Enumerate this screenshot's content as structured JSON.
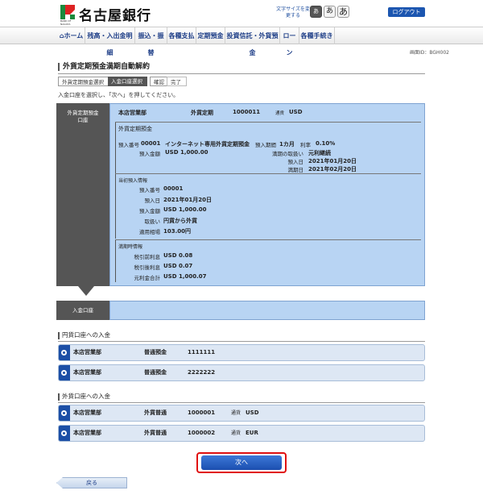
{
  "header": {
    "bank_name": "名古屋銀行",
    "logo_sub": "BANK OF NAGOYA",
    "font_size_label": "文字サイズを変更する",
    "font_btn_small": "あ",
    "font_btn_medium": "あ",
    "font_btn_large": "あ",
    "logout": "ログアウト"
  },
  "nav": {
    "items": [
      "ホーム",
      "残高・入出金明細",
      "振込・振替",
      "各種支払",
      "定期預金",
      "投資信託・外貨預金",
      "ローン",
      "各種手続き"
    ]
  },
  "screen_id": "画面ID：BGH002",
  "page_title": "外貨定期預金満期自動解約",
  "steps": [
    "外貨定期預金選択",
    "入金口座選択",
    "確認",
    "完了"
  ],
  "instruction": "入金口座を選択し、「次へ」を押してください。",
  "source_account": {
    "label_line1": "外貨定期預金",
    "label_line2": "口座",
    "branch": "本店営業部",
    "type": "外貨定期",
    "number": "1000011",
    "currency_label": "通貨",
    "currency": "USD",
    "section1_title": "外貨定期預金",
    "deposit_no_label": "預入番号",
    "deposit_no": "00001",
    "product": "インターネット専用外貨定期預金",
    "period_label": "預入期間",
    "period": "1カ月",
    "rate_label": "利率",
    "rate": "0.10%",
    "amount_label": "預入金額",
    "amount": "USD 1,000.00",
    "maturity_handling_label": "満期の取扱い",
    "maturity_handling": "元利継続",
    "deposit_date_label": "預入日",
    "deposit_date": "2021年01月20日",
    "maturity_date_label": "満期日",
    "maturity_date": "2021年02月20日",
    "section2_title": "当初預入情報",
    "init_no_label": "預入番号",
    "init_no": "00001",
    "init_date_label": "預入日",
    "init_date": "2021年01月20日",
    "init_amount_label": "預入金額",
    "init_amount": "USD 1,000.00",
    "init_handling_label": "取扱い",
    "init_handling": "円貨から外貨",
    "init_rate_label": "適用相場",
    "init_rate": "103.00円",
    "section3_title": "満期時情報",
    "pre_tax_label": "税引前利息",
    "pre_tax": "USD 0.08",
    "post_tax_label": "税引後利息",
    "post_tax": "USD 0.07",
    "total_label": "元利金合計",
    "total": "USD 1,000.07"
  },
  "deposit_account_label": "入金口座",
  "yen_group_title": "円貨口座への入金",
  "yen_accounts": [
    {
      "branch": "本店営業部",
      "type": "普通預金",
      "number": "1111111"
    },
    {
      "branch": "本店営業部",
      "type": "普通預金",
      "number": "2222222"
    }
  ],
  "fx_group_title": "外貨口座への入金",
  "fx_accounts": [
    {
      "branch": "本店営業部",
      "type": "外貨普通",
      "number": "1000001",
      "currency_label": "通貨",
      "currency": "USD"
    },
    {
      "branch": "本店営業部",
      "type": "外貨普通",
      "number": "1000002",
      "currency_label": "通貨",
      "currency": "EUR"
    }
  ],
  "next_button": "次へ",
  "back_button": "戻る",
  "colors": {
    "accent_blue": "#1c4fa6",
    "panel_blue": "#b8d4f3",
    "highlight_red": "#e01010",
    "dark_gray": "#555555"
  }
}
